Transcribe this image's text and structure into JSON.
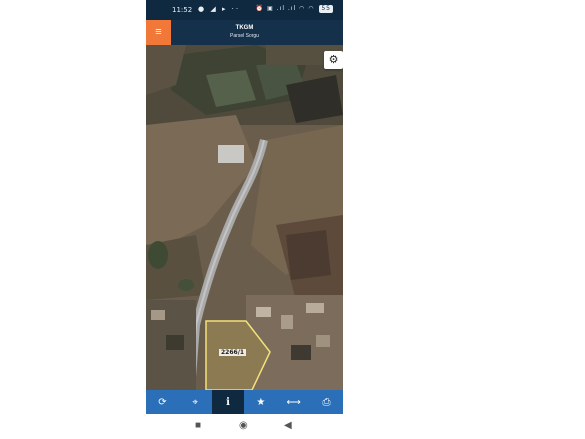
{
  "status_bar": {
    "time": "11:52",
    "left_icons": "● ◢ ▸ ··",
    "right_icons": "⏰ ▣ .ıl .ıl ◠ ◠",
    "battery": "55"
  },
  "app_bar": {
    "title": "TKGM",
    "subtitle": "Parsel Sorgu"
  },
  "map": {
    "parcel_label": "2266/1"
  },
  "toolbar": {
    "buttons": [
      {
        "icon": "refresh-icon",
        "glyph": "⟳"
      },
      {
        "icon": "locate-icon",
        "glyph": "⌖"
      },
      {
        "icon": "info-icon",
        "glyph": "i",
        "active": true
      },
      {
        "icon": "star-icon",
        "glyph": "★"
      },
      {
        "icon": "measure-icon",
        "glyph": "⟷"
      },
      {
        "icon": "print-icon",
        "glyph": "⎙"
      }
    ]
  },
  "nav_bar": {
    "recents": "■",
    "home": "◉",
    "back": "◀"
  },
  "colors": {
    "status_bar": "#0f2a40",
    "app_bar": "#14304a",
    "menu_button": "#f2783a",
    "toolbar": "#2a6fb8",
    "parcel_outline": "#f3e27a"
  }
}
